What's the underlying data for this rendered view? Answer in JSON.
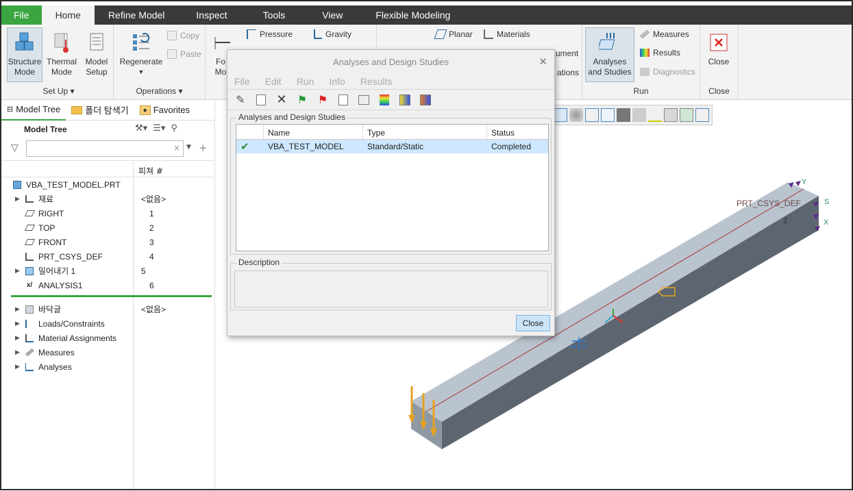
{
  "tabs": [
    "File",
    "Home",
    "Refine Model",
    "Inspect",
    "Tools",
    "View",
    "Flexible Modeling"
  ],
  "ribbon": {
    "setup": {
      "structure_mode": [
        "Structure",
        "Mode"
      ],
      "thermal_mode": [
        "Thermal",
        "Mode"
      ],
      "model_setup": [
        "Model",
        "Setup"
      ],
      "label": "Set Up ▾"
    },
    "operations": {
      "regenerate": "Regenerate",
      "copy": "Copy",
      "paste": "Paste",
      "label": "Operations ▾"
    },
    "loads": {
      "force_partial": [
        "Fo",
        "Mo"
      ],
      "pressure": "Pressure",
      "gravity": "Gravity"
    },
    "planar": "Planar",
    "materials": "Materials",
    "ument": "ument",
    "ations": "ations",
    "run": {
      "analyses": [
        "Analyses",
        "and Studies"
      ],
      "measures": "Measures",
      "results": "Results",
      "diagnostics": "Diagnostics",
      "label": "Run"
    },
    "close": {
      "button": "Close",
      "label": "Close"
    }
  },
  "panel": {
    "tabs": [
      "Model Tree",
      "폴더 탐색기",
      "Favorites"
    ],
    "header": "Model Tree",
    "feat_header": "피쳐 #",
    "root": "VBA_TEST_MODEL.PRT",
    "items": [
      {
        "label": "재료",
        "feat": "<없음>",
        "expand": true
      },
      {
        "label": "RIGHT",
        "feat": "1",
        "expand": false
      },
      {
        "label": "TOP",
        "feat": "2",
        "expand": false
      },
      {
        "label": "FRONT",
        "feat": "3",
        "expand": false
      },
      {
        "label": "PRT_CSYS_DEF",
        "feat": "4",
        "expand": false
      },
      {
        "label": "밀어내기 1",
        "feat": "5",
        "expand": true
      },
      {
        "label": "ANALYSIS1",
        "feat": "6",
        "expand": false
      }
    ],
    "items2": [
      {
        "label": "바닥글",
        "feat": "<없음>"
      },
      {
        "label": "Loads/Constraints",
        "feat": ""
      },
      {
        "label": "Material Assignments",
        "feat": ""
      },
      {
        "label": "Measures",
        "feat": ""
      },
      {
        "label": "Analyses",
        "feat": ""
      }
    ]
  },
  "dialog": {
    "title": "Analyses and Design Studies",
    "menu": [
      "File",
      "Edit",
      "Run",
      "Info",
      "Results"
    ],
    "group_label": "Analyses and Design Studies",
    "columns": [
      "Name",
      "Type",
      "Status"
    ],
    "rows": [
      {
        "name": "VBA_TEST_MODEL",
        "type": "Standard/Static",
        "status": "Completed"
      }
    ],
    "description_label": "Description",
    "close": "Close"
  },
  "viewport": {
    "csys_label": "PRT_CSYS_DEF",
    "axis_x": "X",
    "axis_y": "Y",
    "axis_z": "Z",
    "axis_s": "S"
  }
}
